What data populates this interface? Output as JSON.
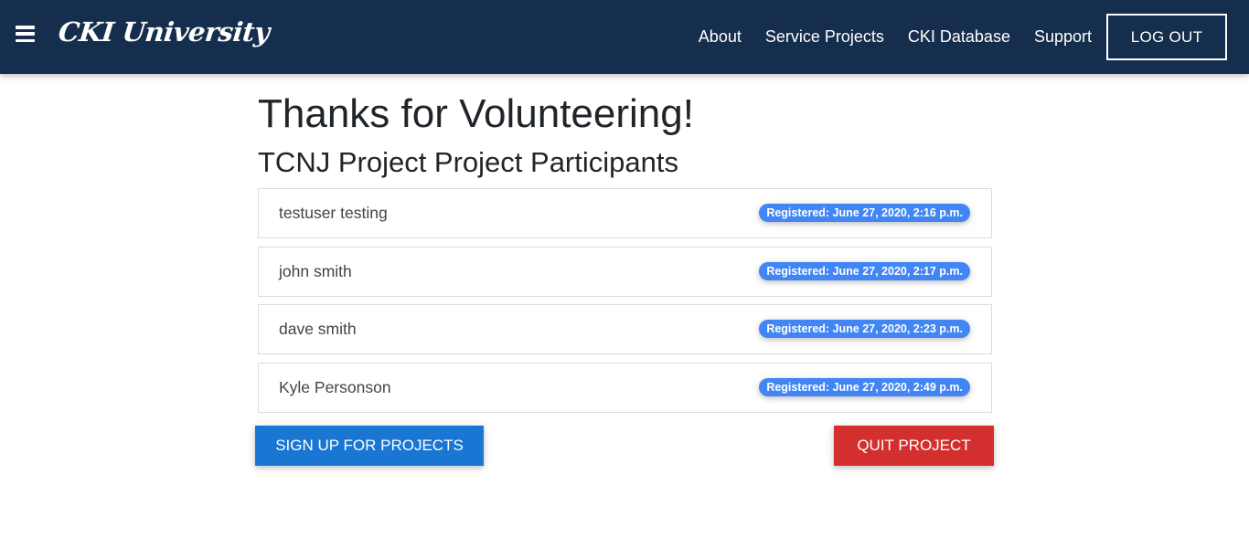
{
  "colors": {
    "nav_bg": "#152e4d",
    "badge_bg": "#4285f4",
    "primary": "#1976d2",
    "danger": "#d32f2f"
  },
  "navbar": {
    "menu_icon": "hamburger-icon",
    "brand": "CKI University",
    "links": [
      "About",
      "Service Projects",
      "CKI Database",
      "Support"
    ],
    "logout_label": "LOG OUT"
  },
  "page": {
    "title": "Thanks for Volunteering!",
    "subtitle": "TCNJ Project Project Participants"
  },
  "participants": [
    {
      "name": "testuser testing",
      "registered": "Registered: June 27, 2020, 2:16 p.m."
    },
    {
      "name": "john smith",
      "registered": "Registered: June 27, 2020, 2:17 p.m."
    },
    {
      "name": "dave smith",
      "registered": "Registered: June 27, 2020, 2:23 p.m."
    },
    {
      "name": "Kyle Personson",
      "registered": "Registered: June 27, 2020, 2:49 p.m."
    }
  ],
  "actions": {
    "signup_label": "SIGN UP FOR PROJECTS",
    "quit_label": "QUIT PROJECT"
  }
}
